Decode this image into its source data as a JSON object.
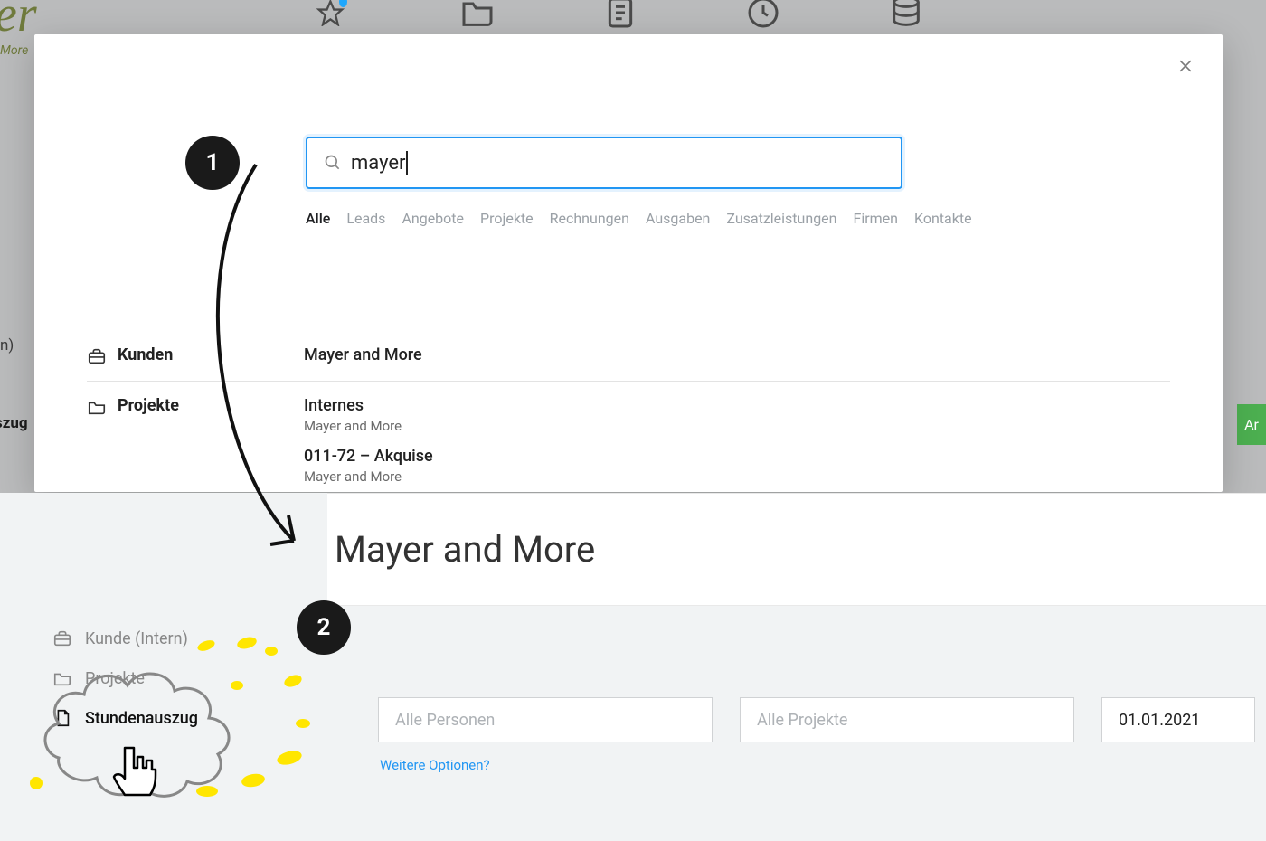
{
  "background": {
    "logo_fragment": "er",
    "logo_sub_fragment": "More",
    "left_text_1": "n)",
    "left_text_2": "szug",
    "green_btn_text": "Ar"
  },
  "modal": {
    "search_value": "mayer",
    "tabs": {
      "alle": "Alle",
      "leads": "Leads",
      "angebote": "Angebote",
      "projekte": "Projekte",
      "rechnungen": "Rechnungen",
      "ausgaben": "Ausgaben",
      "zusatz": "Zusatzleistungen",
      "firmen": "Firmen",
      "kontakte": "Kontakte"
    },
    "groups": {
      "kunden_label": "Kunden",
      "projekte_label": "Projekte",
      "kunden": [
        {
          "title": "Mayer and More"
        }
      ],
      "projekte": [
        {
          "title": "Internes",
          "sub": "Mayer and More"
        },
        {
          "title": "011-72 – Akquise",
          "sub": "Mayer and More"
        }
      ]
    }
  },
  "page": {
    "title": "Mayer and More",
    "sidenav": {
      "kunde": "Kunde (Intern)",
      "projekte": "Projekte",
      "stundenauszug": "Stundenauszug"
    },
    "filters": {
      "persons_placeholder": "Alle Personen",
      "projects_placeholder": "Alle Projekte",
      "date_value": "01.01.2021 ",
      "more_options": "Weitere Optionen?"
    }
  },
  "callouts": {
    "step1": "1",
    "step2": "2"
  }
}
